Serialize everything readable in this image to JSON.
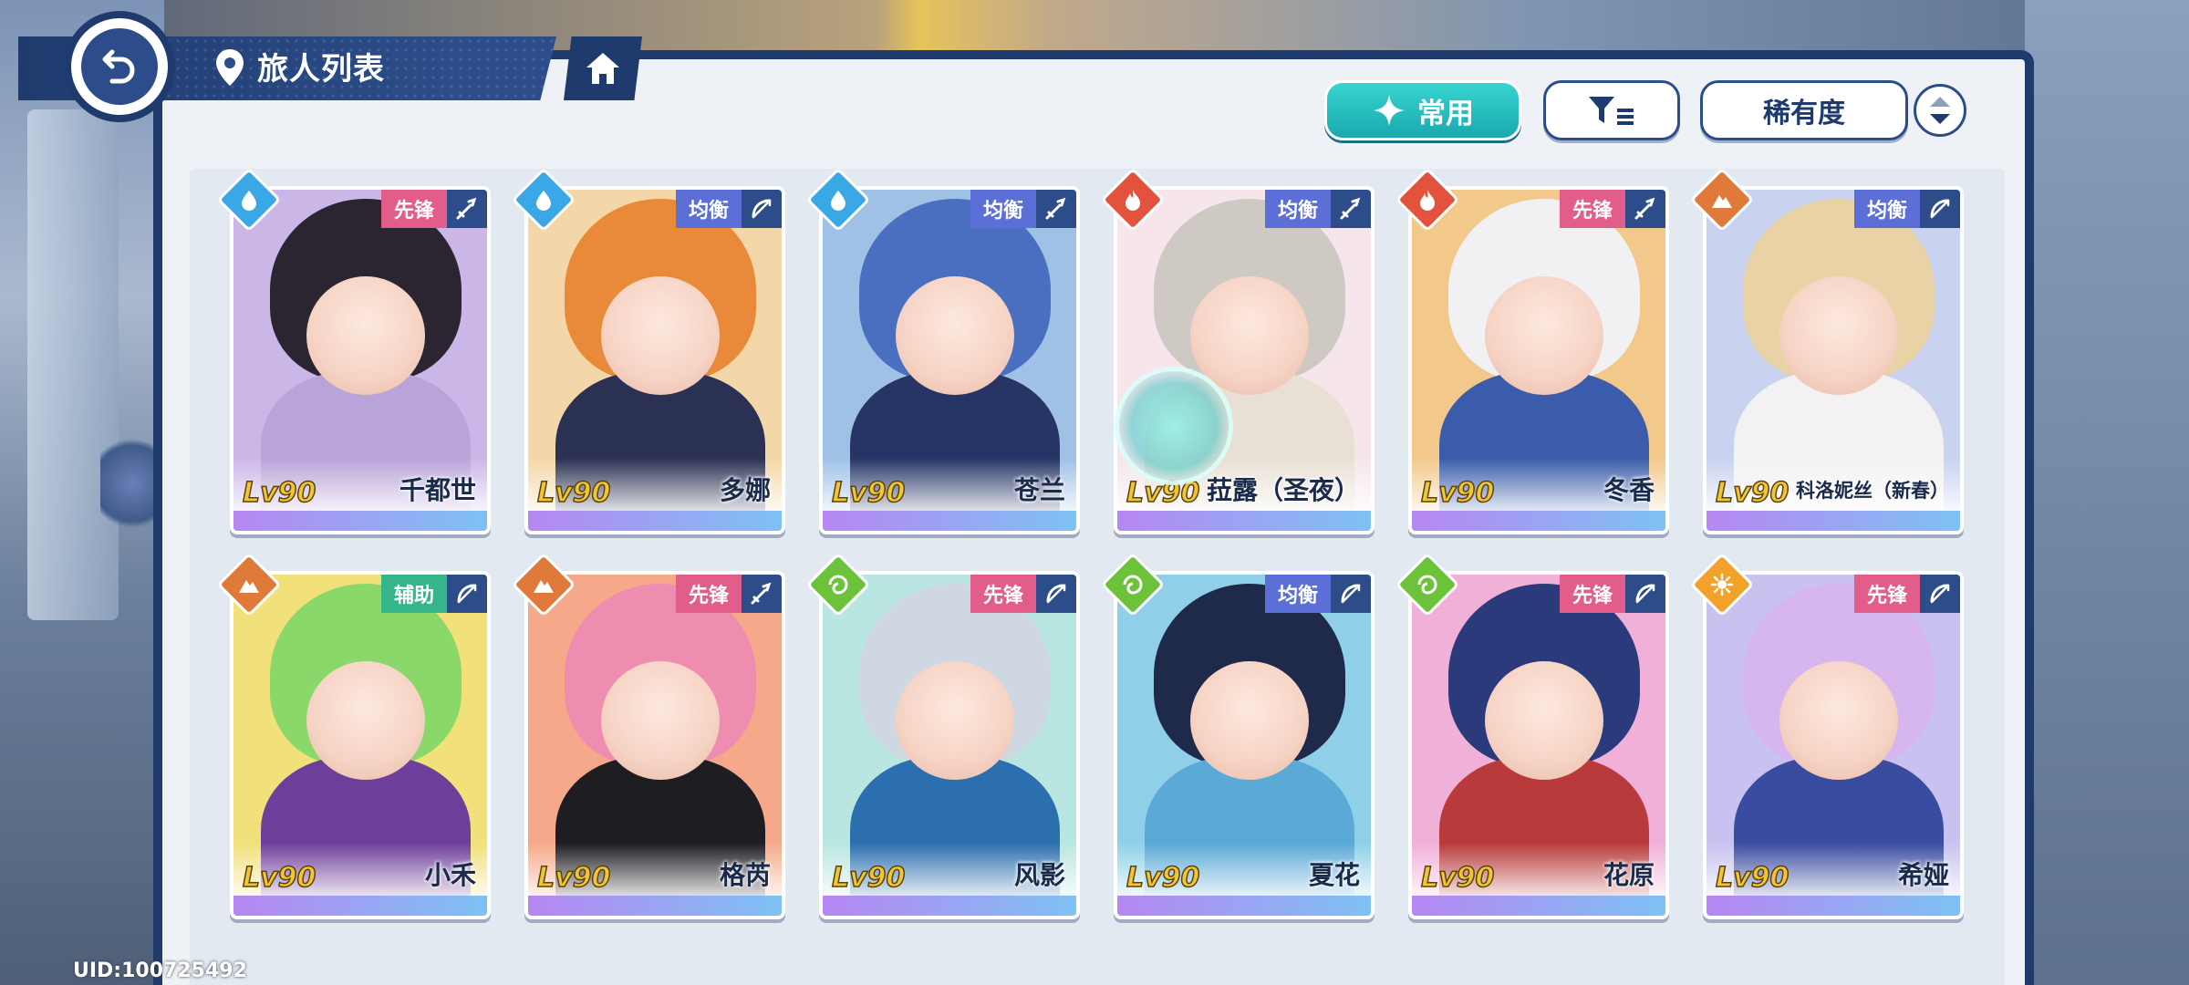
{
  "header": {
    "title": "旅人列表"
  },
  "controls": {
    "common_label": "常用",
    "sort_label": "稀有度"
  },
  "footer": {
    "uid": "UID:100725492"
  },
  "colors": {
    "water": "#3aa8e6",
    "fire": "#e2523c",
    "earth": "#e07a3a",
    "wind": "#6cc23a",
    "light": "#f2a22a",
    "role_vanguard": "#e35d8a",
    "role_balance": "#5b6fd6",
    "role_support": "#36b58a"
  },
  "characters": [
    {
      "name": "千都世",
      "level": "Lv90",
      "role": "先锋",
      "element": "water-icon",
      "weapon": "sword-icon"
    },
    {
      "name": "多娜",
      "level": "Lv90",
      "role": "均衡",
      "element": "water-icon",
      "weapon": "bow-icon"
    },
    {
      "name": "苍兰",
      "level": "Lv90",
      "role": "均衡",
      "element": "water-icon",
      "weapon": "sword-icon"
    },
    {
      "name": "菈露（圣夜）",
      "level": "Lv90",
      "role": "均衡",
      "element": "fire-icon",
      "weapon": "sword-icon"
    },
    {
      "name": "冬香",
      "level": "Lv90",
      "role": "先锋",
      "element": "fire-icon",
      "weapon": "sword-icon"
    },
    {
      "name": "科洛妮丝（新春）",
      "level": "Lv90",
      "role": "均衡",
      "element": "earth-icon",
      "weapon": "bow-icon"
    },
    {
      "name": "小禾",
      "level": "Lv90",
      "role": "辅助",
      "element": "earth-icon",
      "weapon": "bow-icon"
    },
    {
      "name": "格芮",
      "level": "Lv90",
      "role": "先锋",
      "element": "earth-icon",
      "weapon": "sword-icon"
    },
    {
      "name": "风影",
      "level": "Lv90",
      "role": "先锋",
      "element": "wind-icon",
      "weapon": "bow-icon"
    },
    {
      "name": "夏花",
      "level": "Lv90",
      "role": "均衡",
      "element": "wind-icon",
      "weapon": "bow-icon"
    },
    {
      "name": "花原",
      "level": "Lv90",
      "role": "先锋",
      "element": "wind-icon",
      "weapon": "bow-icon"
    },
    {
      "name": "希娅",
      "level": "Lv90",
      "role": "先锋",
      "element": "light-icon",
      "weapon": "bow-icon"
    }
  ]
}
